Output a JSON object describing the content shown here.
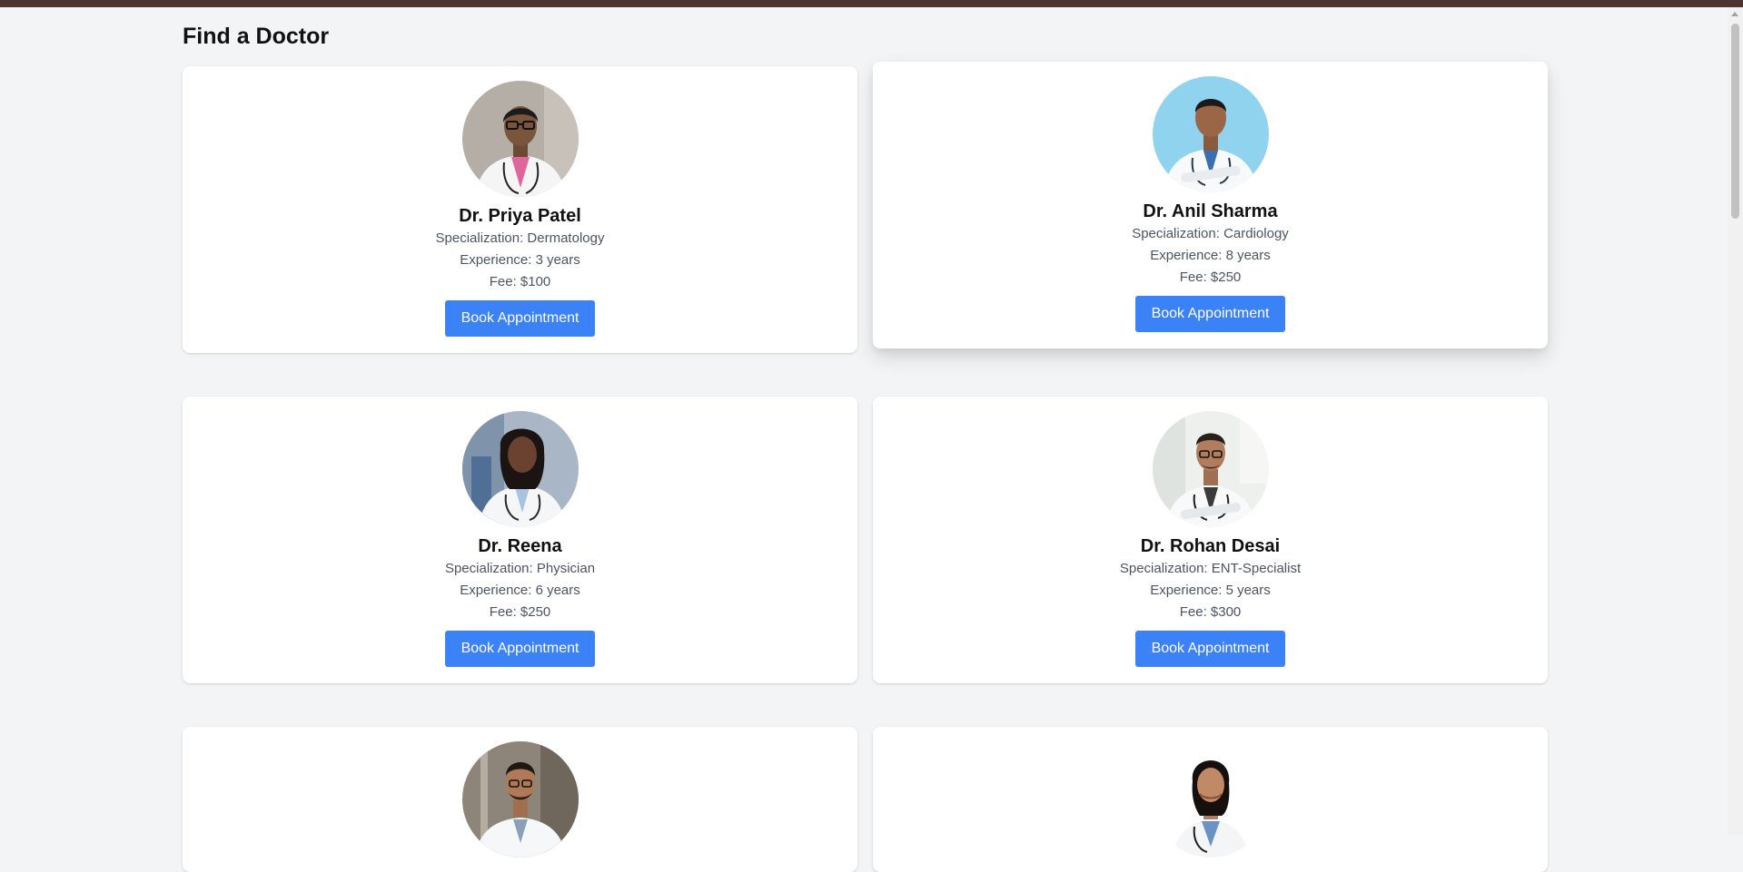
{
  "page": {
    "title": "Find a Doctor"
  },
  "doctors": [
    {
      "name": "Dr. Priya Patel",
      "specialization": "Specialization: Dermatology",
      "experience": "Experience: 3 years",
      "fee": "Fee: $100",
      "button": "Book Appointment"
    },
    {
      "name": "Dr. Anil Sharma",
      "specialization": "Specialization: Cardiology",
      "experience": "Experience: 8 years",
      "fee": "Fee: $250",
      "button": "Book Appointment"
    },
    {
      "name": "Dr. Reena",
      "specialization": "Specialization: Physician",
      "experience": "Experience: 6 years",
      "fee": "Fee: $250",
      "button": "Book Appointment"
    },
    {
      "name": "Dr. Rohan Desai",
      "specialization": "Specialization: ENT-Specialist",
      "experience": "Experience: 5 years",
      "fee": "Fee: $300",
      "button": "Book Appointment"
    }
  ],
  "colors": {
    "topbar": "#4e342e",
    "background": "#f3f4f6",
    "button": "#3b82f6"
  }
}
